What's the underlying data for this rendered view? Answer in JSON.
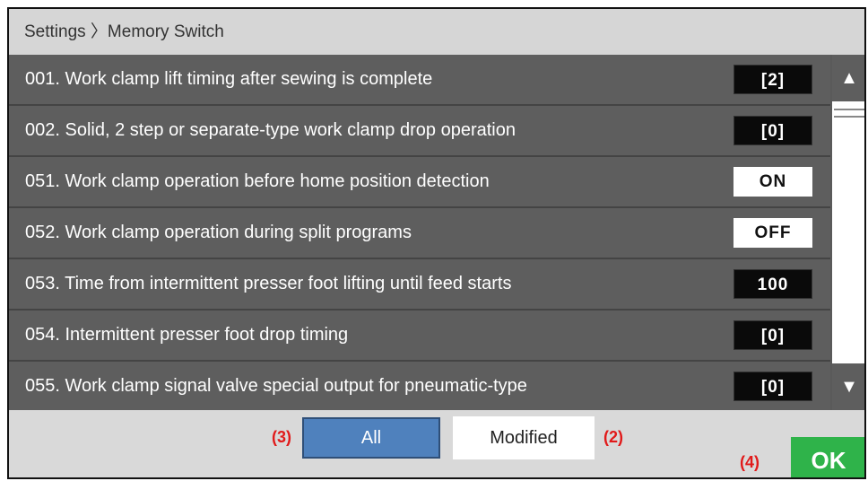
{
  "breadcrumb": "Settings 〉Memory Switch",
  "rows": [
    {
      "label": "001. Work clamp lift timing after sewing is complete",
      "value": "[2]",
      "style": "dark"
    },
    {
      "label": "002. Solid, 2 step or separate-type work clamp drop operation",
      "value": "[0]",
      "style": "dark"
    },
    {
      "label": "051. Work clamp operation before home position detection",
      "value": "ON",
      "style": "light"
    },
    {
      "label": "052. Work clamp operation during split programs",
      "value": "OFF",
      "style": "light"
    },
    {
      "label": "053. Time from intermittent presser foot lifting until feed starts",
      "value": "100",
      "style": "dark"
    },
    {
      "label": "054. Intermittent presser foot drop timing",
      "value": "[0]",
      "style": "dark"
    },
    {
      "label": "055. Work clamp signal valve special output for pneumatic-type",
      "value": "[0]",
      "style": "dark"
    }
  ],
  "scroll": {
    "up": "▲",
    "down": "▼"
  },
  "filters": {
    "all_label": "All",
    "modified_label": "Modified"
  },
  "annotations": {
    "all": "(3)",
    "modified": "(2)",
    "ok": "(4)"
  },
  "ok_label": "OK",
  "colors": {
    "accent_blue": "#4f81bd",
    "ok_green": "#2fb34a",
    "annotation_red": "#e11a1a"
  }
}
